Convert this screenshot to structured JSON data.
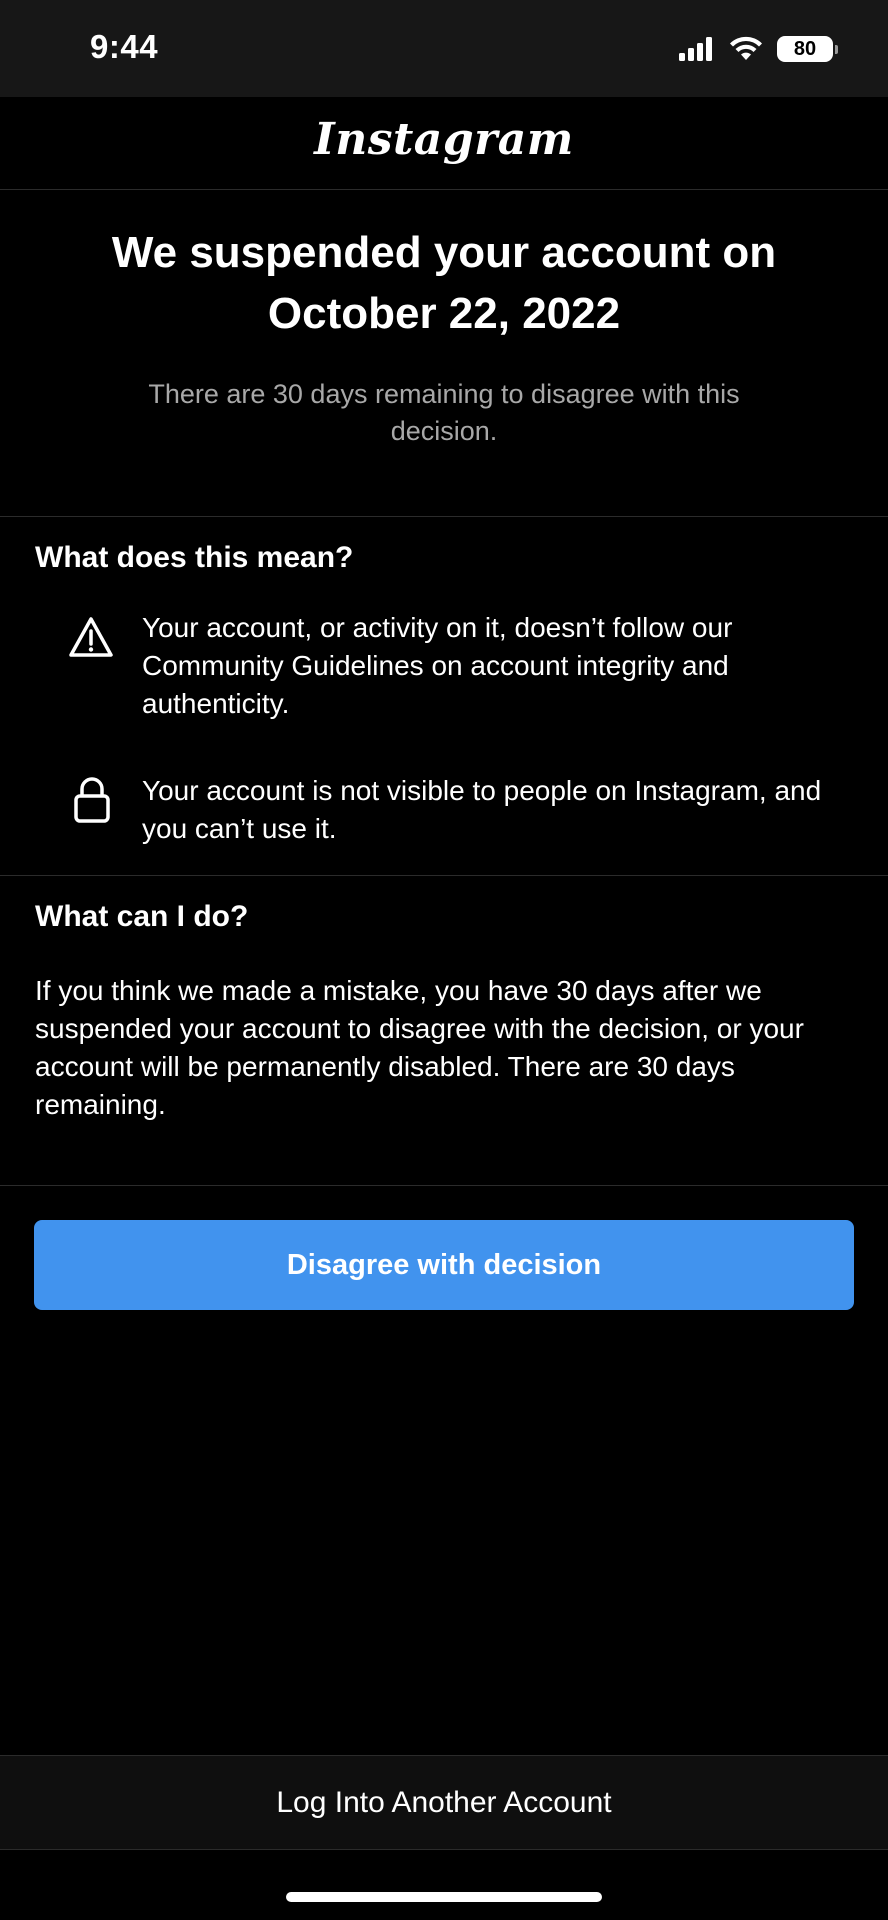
{
  "status_bar": {
    "time": "9:44",
    "battery_level": "80",
    "icons": [
      "cellular-signal-icon",
      "wifi-icon",
      "battery-icon"
    ]
  },
  "header": {
    "logo_text": "Instagram"
  },
  "hero": {
    "title": "We suspended your account on October 22, 2022",
    "subtitle": "There are 30 days remaining to disagree with this decision."
  },
  "meaning_section": {
    "heading": "What does this mean?",
    "items": [
      {
        "icon": "warning-icon",
        "text": "Your account, or activity on it, doesn’t follow our Community Guidelines on account integrity and authenticity."
      },
      {
        "icon": "lock-icon",
        "text": "Your account is not visible to people on Instagram, and you can’t use it."
      }
    ]
  },
  "action_section": {
    "heading": "What can I do?",
    "body": "If you think we made a mistake, you have 30 days after we suspended your account to disagree with the decision, or your account will be permanently disabled. There are 30 days remaining."
  },
  "primary_action": {
    "label": "Disagree with decision"
  },
  "footer": {
    "link_label": "Log Into Another Account"
  },
  "colors": {
    "background": "#000000",
    "status_bar_bg": "#171717",
    "primary_button": "#4193EE",
    "muted_text": "#A8A8A8",
    "divider": "#2B2B2B"
  }
}
